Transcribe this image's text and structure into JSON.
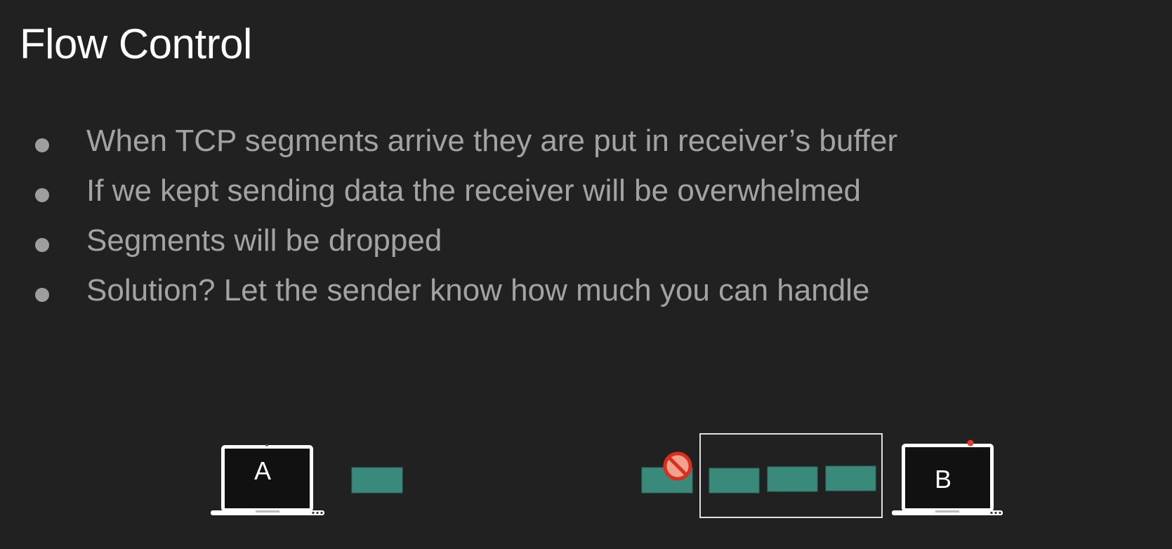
{
  "slide": {
    "title": "Flow Control"
  },
  "bullets": [
    "When TCP segments arrive they are put in receiver’s buffer",
    "If we kept sending data the receiver will be overwhelmed",
    "Segments will be dropped",
    "Solution? Let the sender know how much you can handle"
  ],
  "diagram": {
    "sender_label": "A",
    "receiver_label": "B",
    "segment_color": "#3a8a7c",
    "drop_icon_color": "#d9301e",
    "receiver_buffer": {
      "capacity": 3,
      "filled": 3
    },
    "icons": [
      "laptop-icon",
      "no-entry-icon",
      "laptop-icon"
    ]
  }
}
